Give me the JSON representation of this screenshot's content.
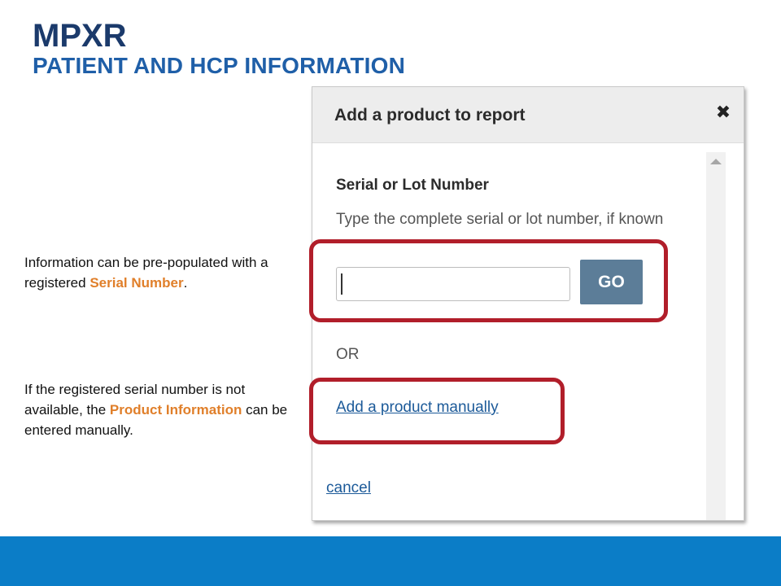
{
  "slide": {
    "title": "MPXR",
    "subtitle": "PATIENT AND HCP INFORMATION"
  },
  "notes": {
    "serial": {
      "before": "Information can be pre-populated with a registered ",
      "highlight": "Serial Number",
      "after": "."
    },
    "manual": {
      "before": "If the registered serial number is not available, the ",
      "highlight": "Product Information",
      "after": " can be entered manually."
    }
  },
  "dialog": {
    "title": "Add a product to report",
    "close_icon": "close-x-icon",
    "field_label": "Serial or Lot Number",
    "field_help": "Type the complete serial or lot number, if known",
    "serial_input_value": "",
    "go_label": "GO",
    "or_text": "OR",
    "add_manually_label": "Add a product manually",
    "cancel_label": "cancel"
  },
  "colors": {
    "title": "#1b3a6b",
    "subtitle": "#1f5fa8",
    "highlight_text": "#e07f2a",
    "callout_border": "#b11e2a",
    "go_button": "#5c7d98",
    "link": "#1c5a99",
    "footer": "#0b7dc7"
  }
}
